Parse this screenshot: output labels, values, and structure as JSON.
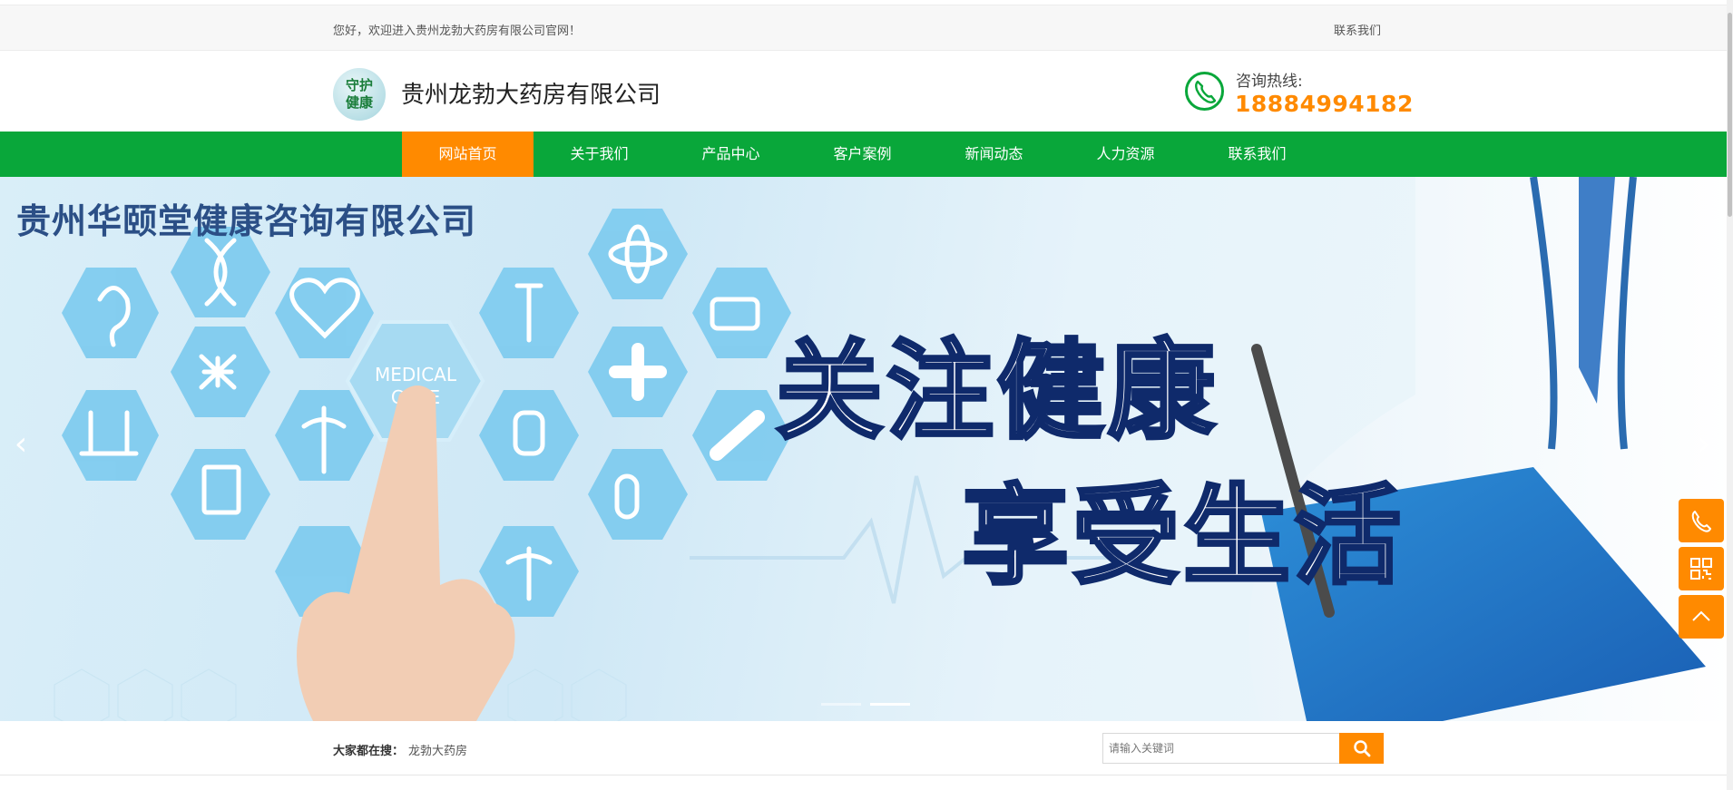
{
  "topbar": {
    "welcome": "您好，欢迎进入贵州龙勃大药房有限公司官网！",
    "contact_link": "联系我们"
  },
  "header": {
    "logo_line1": "守护",
    "logo_line2": "健康",
    "company_name": "贵州龙勃大药房有限公司",
    "hotline_label": "咨询热线:",
    "hotline_number": "18884994182"
  },
  "nav": {
    "items": [
      {
        "label": "网站首页",
        "active": true
      },
      {
        "label": "关于我们"
      },
      {
        "label": "产品中心"
      },
      {
        "label": "客户案例"
      },
      {
        "label": "新闻动态"
      },
      {
        "label": "人力资源"
      },
      {
        "label": "联系我们"
      }
    ]
  },
  "banner": {
    "company_text": "贵州华颐堂健康咨询有限公司",
    "hex_label_line1": "MEDICAL",
    "hex_label_line2": "CARE",
    "slogan_line1": "关注健康",
    "slogan_line2": "享受生活",
    "slide_count": 2,
    "active_slide": 2,
    "prev_arrow": "‹",
    "next_arrow": "›"
  },
  "side_tools": {
    "icons": [
      "phone-icon",
      "qrcode-icon",
      "back-to-top-icon"
    ]
  },
  "search": {
    "label": "大家都在搜：",
    "keyword": "龙勃大药房",
    "placeholder": "请输入关键词"
  },
  "colors": {
    "nav_green": "#09a73a",
    "accent_orange": "#ff8a00",
    "hotline_orange": "#ff8a00",
    "slogan_stroke": "#0f2a6b"
  }
}
